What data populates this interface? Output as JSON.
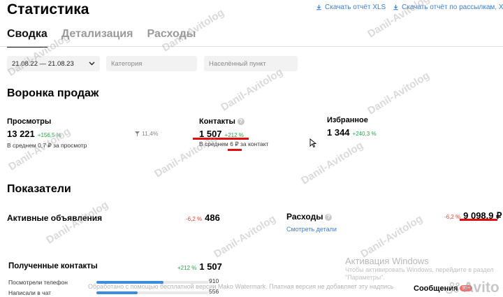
{
  "header": {
    "title": "Статистика",
    "download_xls": "Скачать отчёт XLS",
    "download_mailing": "Скачать отчёт по рассылкам, XLS"
  },
  "tabs": [
    {
      "label": "Сводка",
      "active": true
    },
    {
      "label": "Детализация",
      "active": false
    },
    {
      "label": "Расходы",
      "active": false
    }
  ],
  "filters": {
    "dates": "21.08.22 — 21.08.23",
    "category_placeholder": "Категория",
    "city_placeholder": "Населённый пункт"
  },
  "funnel": {
    "title": "Воронка продаж",
    "views": {
      "label": "Просмотры",
      "value": "13 221",
      "delta": "+156,5 %",
      "note": "В среднем 0,7 ₽ за просмотр"
    },
    "conversion": "11,4%",
    "contacts": {
      "label": "Контакты",
      "value": "1 507",
      "delta": "+212 %",
      "note": "В среднем 6 ₽ за контакт"
    },
    "favorites": {
      "label": "Избранное",
      "value": "1 344",
      "delta": "+240,3 %"
    }
  },
  "metrics": {
    "title": "Показатели",
    "active_ads": {
      "label": "Активные объявления",
      "delta": "-6,2 %",
      "value": "486"
    },
    "expenses": {
      "label": "Расходы",
      "delta": "-6,2 %",
      "value": "9 098,9 ₽",
      "link": "Смотреть детали"
    },
    "received_contacts": {
      "label": "Полученные контакты",
      "delta": "+212 %",
      "value": "1 507"
    },
    "phone_views": {
      "label": "Посмотрели телефон",
      "value": "910",
      "fraction": 0.6
    },
    "chat_writes": {
      "label": "Написали в чат",
      "value": "556",
      "fraction": 0.37
    }
  },
  "watermark": {
    "text": "Danil-Avitolog",
    "footer": "Обработано с помощью бесплатной версии Mako Watermark. Платная версия не добавляет эту надпись"
  },
  "windows_activation": {
    "title": "Активация Windows",
    "line1": "Чтобы активировать Windows, перейдите в раздел",
    "line2": "\"Параметры\"."
  },
  "messages": {
    "label": "Сообщения",
    "badge": "99+"
  },
  "avito_logo": "Avito",
  "colors": {
    "accent": "#3c7ddb",
    "positive": "#2ca24c",
    "negative": "#e0483d",
    "highlight": "#e01010"
  }
}
